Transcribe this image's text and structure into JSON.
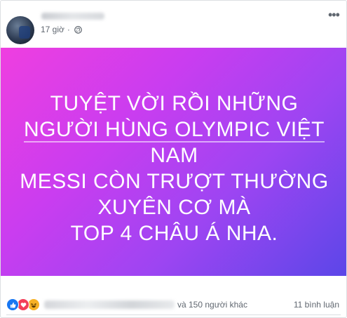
{
  "post": {
    "timestamp": "17 giờ",
    "privacy_icon": "globe-icon",
    "more_icon": "more-dots-icon"
  },
  "image": {
    "lines": [
      "TUYỆT VỜI RỒI NHỮNG",
      "NGƯỜI HÙNG OLYMPIC VIỆT",
      "NAM",
      "MESSI CÒN TRƯỢT THƯỜNG",
      "XUYÊN CƠ MÀ",
      "TOP 4 CHÂU Á NHA."
    ],
    "gradient_colors": [
      "#ef3ee0",
      "#9d45f2",
      "#5b46e8"
    ]
  },
  "footer": {
    "reactions": [
      "like-icon",
      "love-icon",
      "haha-icon"
    ],
    "others_text": "và 150 người khác",
    "comments_text": "11 bình luận"
  }
}
